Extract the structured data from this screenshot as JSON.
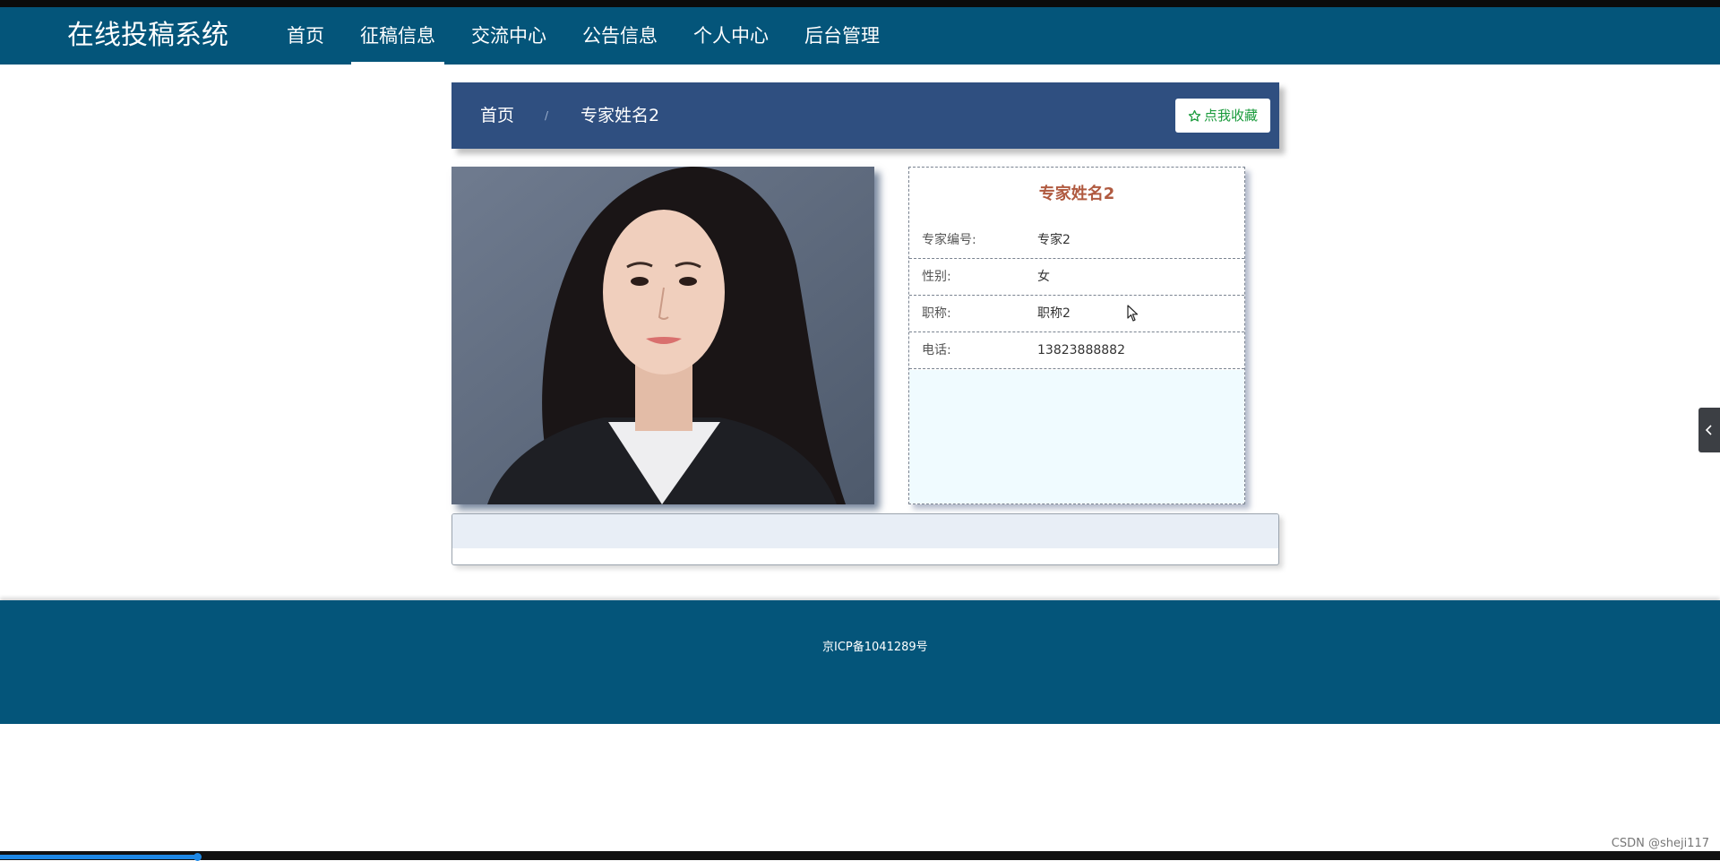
{
  "brand": "在线投稿系统",
  "nav": {
    "items": [
      {
        "label": "首页"
      },
      {
        "label": "征稿信息"
      },
      {
        "label": "交流中心"
      },
      {
        "label": "公告信息"
      },
      {
        "label": "个人中心"
      },
      {
        "label": "后台管理"
      }
    ],
    "active_index": 1
  },
  "breadcrumb": {
    "home": "首页",
    "separator": "/",
    "current": "专家姓名2"
  },
  "favorite_button": {
    "label": "点我收藏",
    "icon": "star-outline-icon",
    "color": "#1a9b3c"
  },
  "expert": {
    "name": "专家姓名2",
    "fields": [
      {
        "label": "专家编号:",
        "value": "专家2"
      },
      {
        "label": "性别:",
        "value": "女"
      },
      {
        "label": "职称:",
        "value": "职称2"
      },
      {
        "label": "电话:",
        "value": "13823888882"
      }
    ]
  },
  "footer": {
    "icp": "京ICP备1041289号"
  },
  "watermark": "CSDN @sheji117",
  "colors": {
    "nav_bg": "#04557a",
    "breadcrumb_bg": "#2f4f80",
    "name_color": "#b05a40",
    "info_fill": "#f0fbff"
  }
}
